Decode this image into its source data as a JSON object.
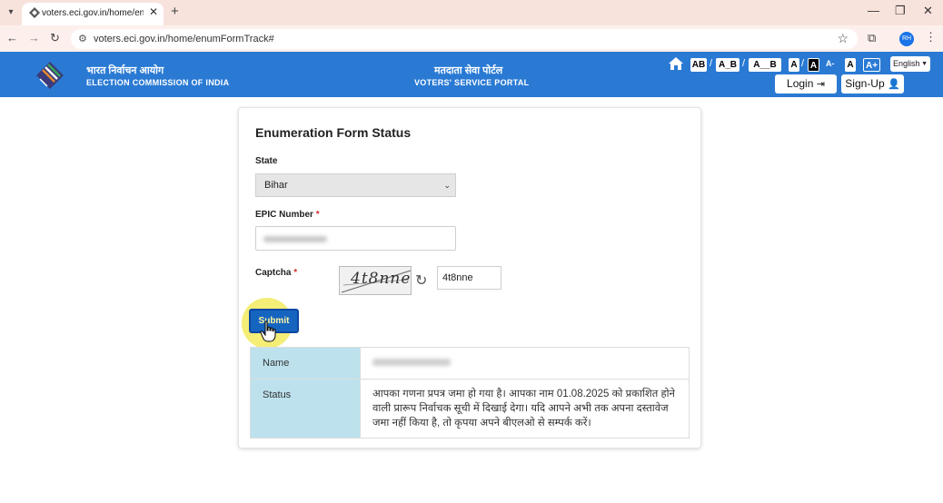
{
  "browser": {
    "tab_title": "voters.eci.gov.in/home/enumFo",
    "url": "voters.eci.gov.in/home/enumFormTrack#",
    "profile_initials": "RH",
    "new_tab_symbol": "+",
    "close_tab_symbol": "✕",
    "minimize_symbol": "—",
    "maximize_symbol": "❐",
    "close_window_symbol": "✕"
  },
  "header": {
    "org_hindi": "भारत निर्वाचन आयोग",
    "org_english": "ELECTION COMMISSION OF INDIA",
    "portal_hindi": "मतदाता सेवा पोर्टल",
    "portal_english": "VOTERS' SERVICE PORTAL",
    "accessibility": {
      "ab": "AB",
      "a_b": "A_B",
      "a__b": "A__B",
      "a_light": "A",
      "a_dark": "A",
      "a_minus": "A-",
      "a_normal": "A",
      "a_plus": "A+"
    },
    "language": "English",
    "login_label": "Login",
    "signup_label": "Sign-Up",
    "colors": {
      "header_bg": "#2a7ad4"
    }
  },
  "form": {
    "title": "Enumeration Form Status",
    "state_label": "State",
    "state_value": "Bihar",
    "epic_label": "EPIC Number",
    "required_mark": "*",
    "captcha_label": "Captcha",
    "captcha_image_text": "4t8nne",
    "captcha_value": "4t8nne",
    "submit_label": "Submit"
  },
  "result": {
    "name_label": "Name",
    "status_label": "Status",
    "status_text": "आपका गणना प्रपत्र जमा हो गया है। आपका नाम 01.08.2025 को प्रकाशित होने वाली प्रारूप निर्वाचक सूची में दिखाई देगा। यदि आपने अभी तक अपना दस्तावेज जमा नहीं किया है, तो कृपया अपने बीएलओ से सम्पर्क करें।"
  }
}
